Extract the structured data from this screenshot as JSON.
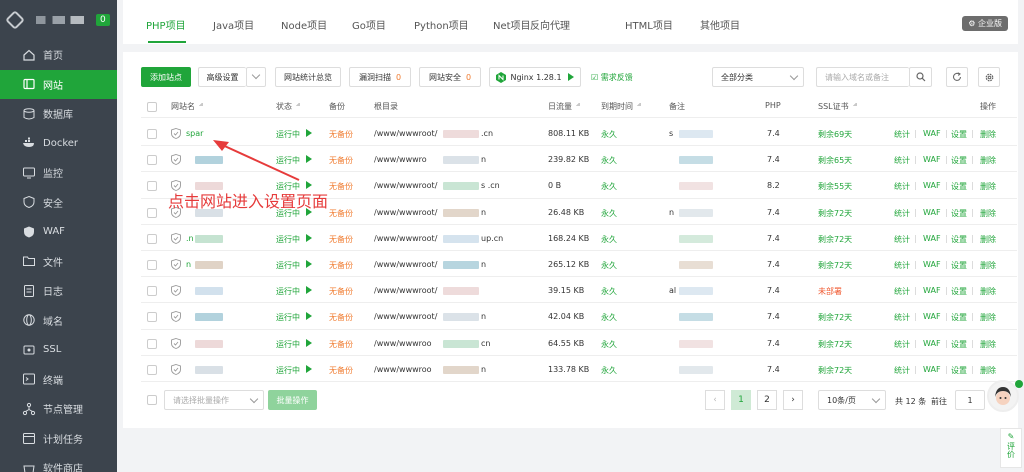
{
  "sidebar": {
    "badge": "0",
    "items": [
      {
        "label": "首页",
        "icon": "home-icon"
      },
      {
        "label": "网站",
        "icon": "website-icon"
      },
      {
        "label": "数据库",
        "icon": "database-icon"
      },
      {
        "label": "Docker",
        "icon": "docker-icon"
      },
      {
        "label": "监控",
        "icon": "monitor-icon"
      },
      {
        "label": "安全",
        "icon": "shield-icon"
      },
      {
        "label": "WAF",
        "icon": "waf-icon"
      },
      {
        "label": "文件",
        "icon": "folder-icon"
      },
      {
        "label": "日志",
        "icon": "log-icon"
      },
      {
        "label": "域名",
        "icon": "globe-icon"
      },
      {
        "label": "SSL",
        "icon": "ssl-icon"
      },
      {
        "label": "终端",
        "icon": "terminal-icon"
      },
      {
        "label": "节点管理",
        "icon": "node-icon"
      },
      {
        "label": "计划任务",
        "icon": "clock-icon"
      },
      {
        "label": "软件商店",
        "icon": "store-icon"
      }
    ]
  },
  "tabs": [
    "PHP项目",
    "Java项目",
    "Node项目",
    "Go项目",
    "Python项目",
    "Net项目",
    "反向代理",
    "HTML项目",
    "其他项目"
  ],
  "enterprise_label": "企业版",
  "toolbar": {
    "add_site": "添加站点",
    "advanced": "高级设置",
    "stats": "网站统计总览",
    "vuln_scan": "漏洞扫描",
    "vuln_count": "0",
    "site_security": "网站安全",
    "security_count": "0",
    "nginx": "Nginx 1.28.1",
    "feedback": "需求反馈",
    "category": "全部分类",
    "search_placeholder": "请输入域名或备注"
  },
  "table": {
    "headers": {
      "name": "网站名",
      "status": "状态",
      "backup": "备份",
      "root": "根目录",
      "traffic": "日流量",
      "expire": "到期时间",
      "remark": "备注",
      "php": "PHP",
      "ssl": "SSL证书",
      "actions": "操作"
    },
    "action_labels": [
      "统计",
      "WAF",
      "设置",
      "删除"
    ],
    "rows": [
      {
        "name": "spar",
        "status": "运行中",
        "backup": "无备份",
        "root": "/www/wwwroot/",
        "root_tail": ".cn",
        "traffic": "808.11 KB",
        "expire": "永久",
        "remark": "s",
        "php": "7.4",
        "ssl": "剩余69天",
        "ssl_state": "ok"
      },
      {
        "name": "",
        "status": "运行中",
        "backup": "无备份",
        "root": "/www/wwwro",
        "root_tail": "n",
        "traffic": "239.82 KB",
        "expire": "永久",
        "remark": "",
        "php": "7.4",
        "ssl": "剩余65天",
        "ssl_state": "ok"
      },
      {
        "name": "",
        "status": "运行中",
        "backup": "无备份",
        "root": "/www/wwwroot/",
        "root_tail": "s .cn",
        "traffic": "0 B",
        "expire": "永久",
        "remark": "",
        "php": "8.2",
        "ssl": "剩余55天",
        "ssl_state": "ok"
      },
      {
        "name": "",
        "status": "运行中",
        "backup": "无备份",
        "root": "/www/wwwroot/",
        "root_tail": "n",
        "traffic": "26.48 KB",
        "expire": "永久",
        "remark": "n",
        "php": "7.4",
        "ssl": "剩余72天",
        "ssl_state": "ok"
      },
      {
        "name": ".n",
        "status": "运行中",
        "backup": "无备份",
        "root": "/www/wwwroot/",
        "root_tail": "up.cn",
        "traffic": "168.24 KB",
        "expire": "永久",
        "remark": "",
        "php": "7.4",
        "ssl": "剩余72天",
        "ssl_state": "ok"
      },
      {
        "name": "n",
        "status": "运行中",
        "backup": "无备份",
        "root": "/www/wwwroot/",
        "root_tail": "n",
        "traffic": "265.12 KB",
        "expire": "永久",
        "remark": "",
        "php": "7.4",
        "ssl": "剩余72天",
        "ssl_state": "ok"
      },
      {
        "name": "",
        "status": "运行中",
        "backup": "无备份",
        "root": "/www/wwwroot/",
        "root_tail": "",
        "traffic": "39.15 KB",
        "expire": "永久",
        "remark": "al",
        "php": "7.4",
        "ssl": "未部署",
        "ssl_state": "none"
      },
      {
        "name": "",
        "status": "运行中",
        "backup": "无备份",
        "root": "/www/wwwroot/",
        "root_tail": "n",
        "traffic": "42.04 KB",
        "expire": "永久",
        "remark": "",
        "php": "7.4",
        "ssl": "剩余72天",
        "ssl_state": "ok"
      },
      {
        "name": "",
        "status": "运行中",
        "backup": "无备份",
        "root": "/www/wwwroo",
        "root_tail": "cn",
        "traffic": "64.55 KB",
        "expire": "永久",
        "remark": "",
        "php": "7.4",
        "ssl": "剩余72天",
        "ssl_state": "ok"
      },
      {
        "name": "",
        "status": "运行中",
        "backup": "无备份",
        "root": "/www/wwwroo",
        "root_tail": "n",
        "traffic": "133.78 KB",
        "expire": "永久",
        "remark": "",
        "php": "7.4",
        "ssl": "剩余72天",
        "ssl_state": "ok"
      }
    ]
  },
  "footer": {
    "batch_placeholder": "请选择批量操作",
    "batch_button": "批量操作",
    "pages": [
      "1",
      "2"
    ],
    "page_size": "10条/页",
    "total": "共 12 条",
    "goto": "前往",
    "goto_value": "1"
  },
  "annotation": "点击网站进入设置页面",
  "rate_label": "评价",
  "colors": {
    "accent": "#20a53a",
    "sidebar": "#3c444d",
    "warning": "#f07b2f",
    "annotation": "#e63b3b"
  }
}
